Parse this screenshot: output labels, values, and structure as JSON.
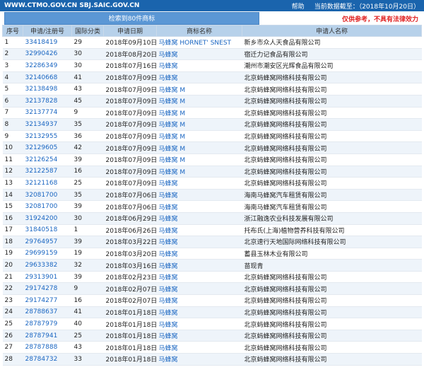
{
  "topbar": {
    "domains": "WWW.CTMO.GOV.CN SBJ.SAIC.GOV.CN",
    "help": "帮助",
    "data_date": "当前数据截至：（2018年10月20日）"
  },
  "search": {
    "result_label": "检索到80件商标",
    "disclaimer": "仅供参考，不具有法律效力"
  },
  "table": {
    "headers": [
      "序号",
      "申请/注册号",
      "国际分类",
      "申请日期",
      "商标名称",
      "申请人名称"
    ],
    "rows": [
      [
        "1",
        "33418419",
        "29",
        "2018年09月10日",
        "马蜂窝 HORNET' SNEST",
        "新乡市众人天食品有限公司"
      ],
      [
        "2",
        "32990426",
        "30",
        "2018年08月20日",
        "马蜂窝",
        "宿迁力记食品有限公司"
      ],
      [
        "3",
        "32286349",
        "30",
        "2018年07月16日",
        "马蜂窝",
        "潮州市潮安区光辉食品有限公司"
      ],
      [
        "4",
        "32140668",
        "41",
        "2018年07月09日",
        "马蜂窝",
        "北京蚂蜂窝网络科技有限公司"
      ],
      [
        "5",
        "32138498",
        "43",
        "2018年07月09日",
        "马蜂窝 M",
        "北京蚂蜂窝网络科技有限公司"
      ],
      [
        "6",
        "32137828",
        "45",
        "2018年07月09日",
        "马蜂窝 M",
        "北京蚂蜂窝网络科技有限公司"
      ],
      [
        "7",
        "32137774",
        "9",
        "2018年07月09日",
        "马蜂窝 M",
        "北京蚂蜂窝网络科技有限公司"
      ],
      [
        "8",
        "32134937",
        "35",
        "2018年07月09日",
        "马蜂窝 M",
        "北京蚂蜂窝网络科技有限公司"
      ],
      [
        "9",
        "32132955",
        "36",
        "2018年07月09日",
        "马蜂窝 M",
        "北京蚂蜂窝网络科技有限公司"
      ],
      [
        "10",
        "32129605",
        "42",
        "2018年07月09日",
        "马蜂窝 M",
        "北京蚂蜂窝网络科技有限公司"
      ],
      [
        "11",
        "32126254",
        "39",
        "2018年07月09日",
        "马蜂窝 M",
        "北京蚂蜂窝网络科技有限公司"
      ],
      [
        "12",
        "32122587",
        "16",
        "2018年07月09日",
        "马蜂窝 M",
        "北京蚂蜂窝网络科技有限公司"
      ],
      [
        "13",
        "32121168",
        "25",
        "2018年07月09日",
        "马蜂窝",
        "北京蚂蜂窝网络科技有限公司"
      ],
      [
        "14",
        "32081700",
        "35",
        "2018年07月06日",
        "马蜂窝",
        "海南马蜂窝汽车租赁有限公司"
      ],
      [
        "15",
        "32081700",
        "39",
        "2018年07月06日",
        "马蜂窝",
        "海南马蜂窝汽车租赁有限公司"
      ],
      [
        "16",
        "31924200",
        "30",
        "2018年06月29日",
        "马蜂窝",
        "浙江融逸农业科技发展有限公司"
      ],
      [
        "17",
        "31840518",
        "1",
        "2018年06月26日",
        "马蜂窝",
        "托布氏(上海)植物营养科技有限公司"
      ],
      [
        "18",
        "29764957",
        "39",
        "2018年03月22日",
        "马蜂窝",
        "北京速行天地国际网络科技有限公司"
      ],
      [
        "19",
        "29699159",
        "19",
        "2018年03月20日",
        "马蜂窝",
        "蓄县玉林木业有限公司"
      ],
      [
        "20",
        "29633382",
        "32",
        "2018年03月16日",
        "马蜂窝",
        "苗现青"
      ],
      [
        "21",
        "29313901",
        "39",
        "2018年02月23日",
        "马蜂窝",
        "北京蚂蜂窝网络科技有限公司"
      ],
      [
        "22",
        "29174278",
        "9",
        "2018年02月07日",
        "马蜂窝",
        "北京蚂蜂窝网络科技有限公司"
      ],
      [
        "23",
        "29174277",
        "16",
        "2018年02月07日",
        "马蜂窝",
        "北京蚂蜂窝网络科技有限公司"
      ],
      [
        "24",
        "28788637",
        "41",
        "2018年01月18日",
        "马蜂窝",
        "北京蚂蜂窝网络科技有限公司"
      ],
      [
        "25",
        "28787979",
        "40",
        "2018年01月18日",
        "马蜂窝",
        "北京蚂蜂窝网络科技有限公司"
      ],
      [
        "26",
        "28787941",
        "25",
        "2018年01月18日",
        "马蜂窝",
        "北京蚂蜂窝网络科技有限公司"
      ],
      [
        "27",
        "28787888",
        "43",
        "2018年01月18日",
        "马蜂窝",
        "北京蚂蜂窝网络科技有限公司"
      ],
      [
        "28",
        "28784732",
        "33",
        "2018年01月18日",
        "马蜂窝",
        "北京蚂蜂窝网络科技有限公司"
      ]
    ]
  }
}
